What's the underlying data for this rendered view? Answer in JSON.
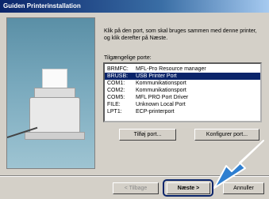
{
  "window": {
    "title": "Guiden Printerinstallation"
  },
  "instructions": "Klik på den port, som skal bruges sammen med denne printer, og klik derefter på Næste.",
  "ports_label": "Tilgængelige porte:",
  "ports": [
    {
      "name": "BRMFC:",
      "desc": "MFL-Pro Resource manager",
      "selected": false
    },
    {
      "name": "BRUSB:",
      "desc": "USB Printer Port",
      "selected": true
    },
    {
      "name": "COM1:",
      "desc": "Kommunikationsport",
      "selected": false
    },
    {
      "name": "COM2:",
      "desc": "Kommunikationsport",
      "selected": false
    },
    {
      "name": "COM5:",
      "desc": "MFL PRO Port Driver",
      "selected": false
    },
    {
      "name": "FILE:",
      "desc": "Unknown Local Port",
      "selected": false
    },
    {
      "name": "LPT1:",
      "desc": "ECP-printerport",
      "selected": false
    }
  ],
  "buttons": {
    "add_port": "Tilføj port...",
    "configure_port": "Konfigurer port...",
    "back": "< Tilbage",
    "next": "Næste >",
    "cancel": "Annuller"
  },
  "colors": {
    "title_bar": "#0a246a",
    "selection": "#0a246a",
    "arrow": "#2f7fd0",
    "highlight_box": "#0a246a"
  },
  "icons": {
    "callout_arrow": "arrow-icon"
  }
}
